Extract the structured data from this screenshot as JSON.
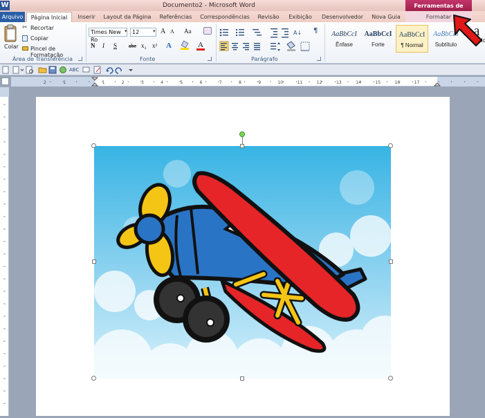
{
  "window": {
    "title": "Documento2 - Microsoft Word",
    "app_icon": "W"
  },
  "context_header": "Ferramentas de Imagem",
  "tabs": [
    "Arquivo",
    "Página Inicial",
    "Inserir",
    "Layout da Página",
    "Referências",
    "Correspondências",
    "Revisão",
    "Exibição",
    "Desenvolvedor",
    "Nova Guia",
    "Formatar"
  ],
  "clipboard": {
    "paste": "Colar",
    "cut": "Recortar",
    "copy": "Copiar",
    "painter": "Pincel de Formatação",
    "label": "Área de Transferência"
  },
  "font": {
    "name": "Times New Ro",
    "size": "12",
    "label": "Fonte",
    "grow": "A",
    "shrink": "A",
    "case": "Aa",
    "bold": "N",
    "italic": "I",
    "underline": "S",
    "strike": "abc",
    "subscript": "x₂",
    "superscript": "x²"
  },
  "paragraph": {
    "label": "Parágrafo",
    "pilcrow": "¶"
  },
  "styles": [
    {
      "sample": "AaBbCcI",
      "name": "Ênfase"
    },
    {
      "sample": "AaBbCcI",
      "name": "Forte"
    },
    {
      "sample": "AaBbCcI",
      "name": "¶ Normal"
    },
    {
      "sample": "AaBbCcI",
      "name": "Subtítulo"
    },
    {
      "sample": "Aa",
      "name": "Título"
    }
  ],
  "ruler_numbers": [
    "2",
    "1",
    "1",
    "2",
    "3",
    "4",
    "5",
    "6",
    "7",
    "8",
    "9",
    "10",
    "11",
    "12",
    "13",
    "14",
    "15",
    "16",
    "17"
  ],
  "colors": {
    "context_tab": "#b1275a",
    "file_tab": "#2a5fa6",
    "highlight": "#ffd700",
    "font_color": "#e02020",
    "sky_top": "#38b4e4",
    "sky_bottom": "#d6f1fb",
    "plane_red": "#e52528",
    "plane_blue": "#2a74c5",
    "plane_yellow": "#f5c515",
    "arrow": "#e01818"
  }
}
